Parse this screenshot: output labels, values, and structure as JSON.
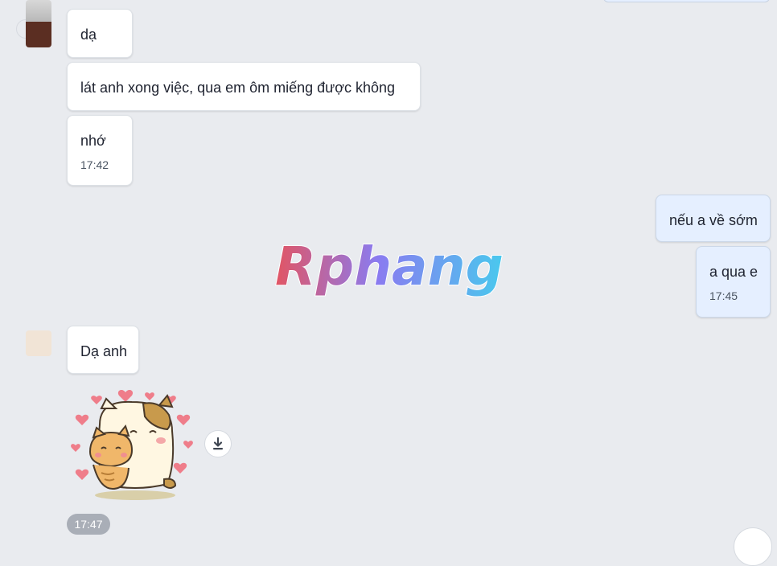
{
  "messages": {
    "m1": "dạ",
    "m2": "lát anh xong việc, qua em ôm miếng được không",
    "m3": "nhớ",
    "m3_time": "17:42",
    "m4": "nếu a về sớm",
    "m5": "a qua e",
    "m5_time": "17:45",
    "m6": "Dạ anh",
    "sticker_time": "17:47"
  },
  "watermark": {
    "text": "Rphang",
    "colors": [
      "#e25563",
      "#8a7bf0",
      "#49c9ee"
    ]
  },
  "icons": {
    "download": "download-icon",
    "sticker": "cat-hug-sticker"
  }
}
